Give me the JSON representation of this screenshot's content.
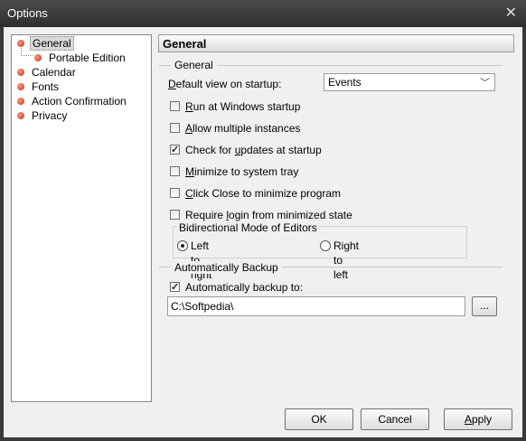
{
  "window": {
    "title": "Options",
    "close_glyph": "✕"
  },
  "tree": {
    "items": [
      {
        "label": "General",
        "selected": true
      },
      {
        "label": "Portable Edition"
      },
      {
        "label": "Calendar"
      },
      {
        "label": "Fonts"
      },
      {
        "label": "Action Confirmation"
      },
      {
        "label": "Privacy"
      }
    ]
  },
  "panel": {
    "header": "General"
  },
  "general_group": {
    "label": "General",
    "default_view_label_pre": "",
    "default_view_label_u": "D",
    "default_view_label_post": "efault view on startup:",
    "default_view_value": "Events",
    "checkboxes": [
      {
        "pre": "",
        "u": "R",
        "post": "un at Windows startup",
        "checked": false
      },
      {
        "pre": "",
        "u": "A",
        "post": "llow multiple instances",
        "checked": false
      },
      {
        "pre": "Check for ",
        "u": "u",
        "post": "pdates at startup",
        "checked": true
      },
      {
        "pre": "",
        "u": "M",
        "post": "inimize to system tray",
        "checked": false
      },
      {
        "pre": "",
        "u": "C",
        "post": "lick Close to minimize program",
        "checked": false
      },
      {
        "pre": "Require ",
        "u": "l",
        "post": "ogin from minimized state",
        "checked": false
      }
    ]
  },
  "bidi_group": {
    "label": "Bidirectional Mode of Editors",
    "options": [
      {
        "label": "Left to right",
        "selected": true
      },
      {
        "label": "Right to left",
        "selected": false
      }
    ]
  },
  "backup_group": {
    "label": "Automatically Backup",
    "checkbox_label": "Automatically backup to:",
    "checked": true,
    "path": "C:\\Softpedia\\",
    "browse_label": "..."
  },
  "buttons": {
    "ok": "OK",
    "cancel": "Cancel",
    "apply_u": "A",
    "apply_post": "pply"
  }
}
